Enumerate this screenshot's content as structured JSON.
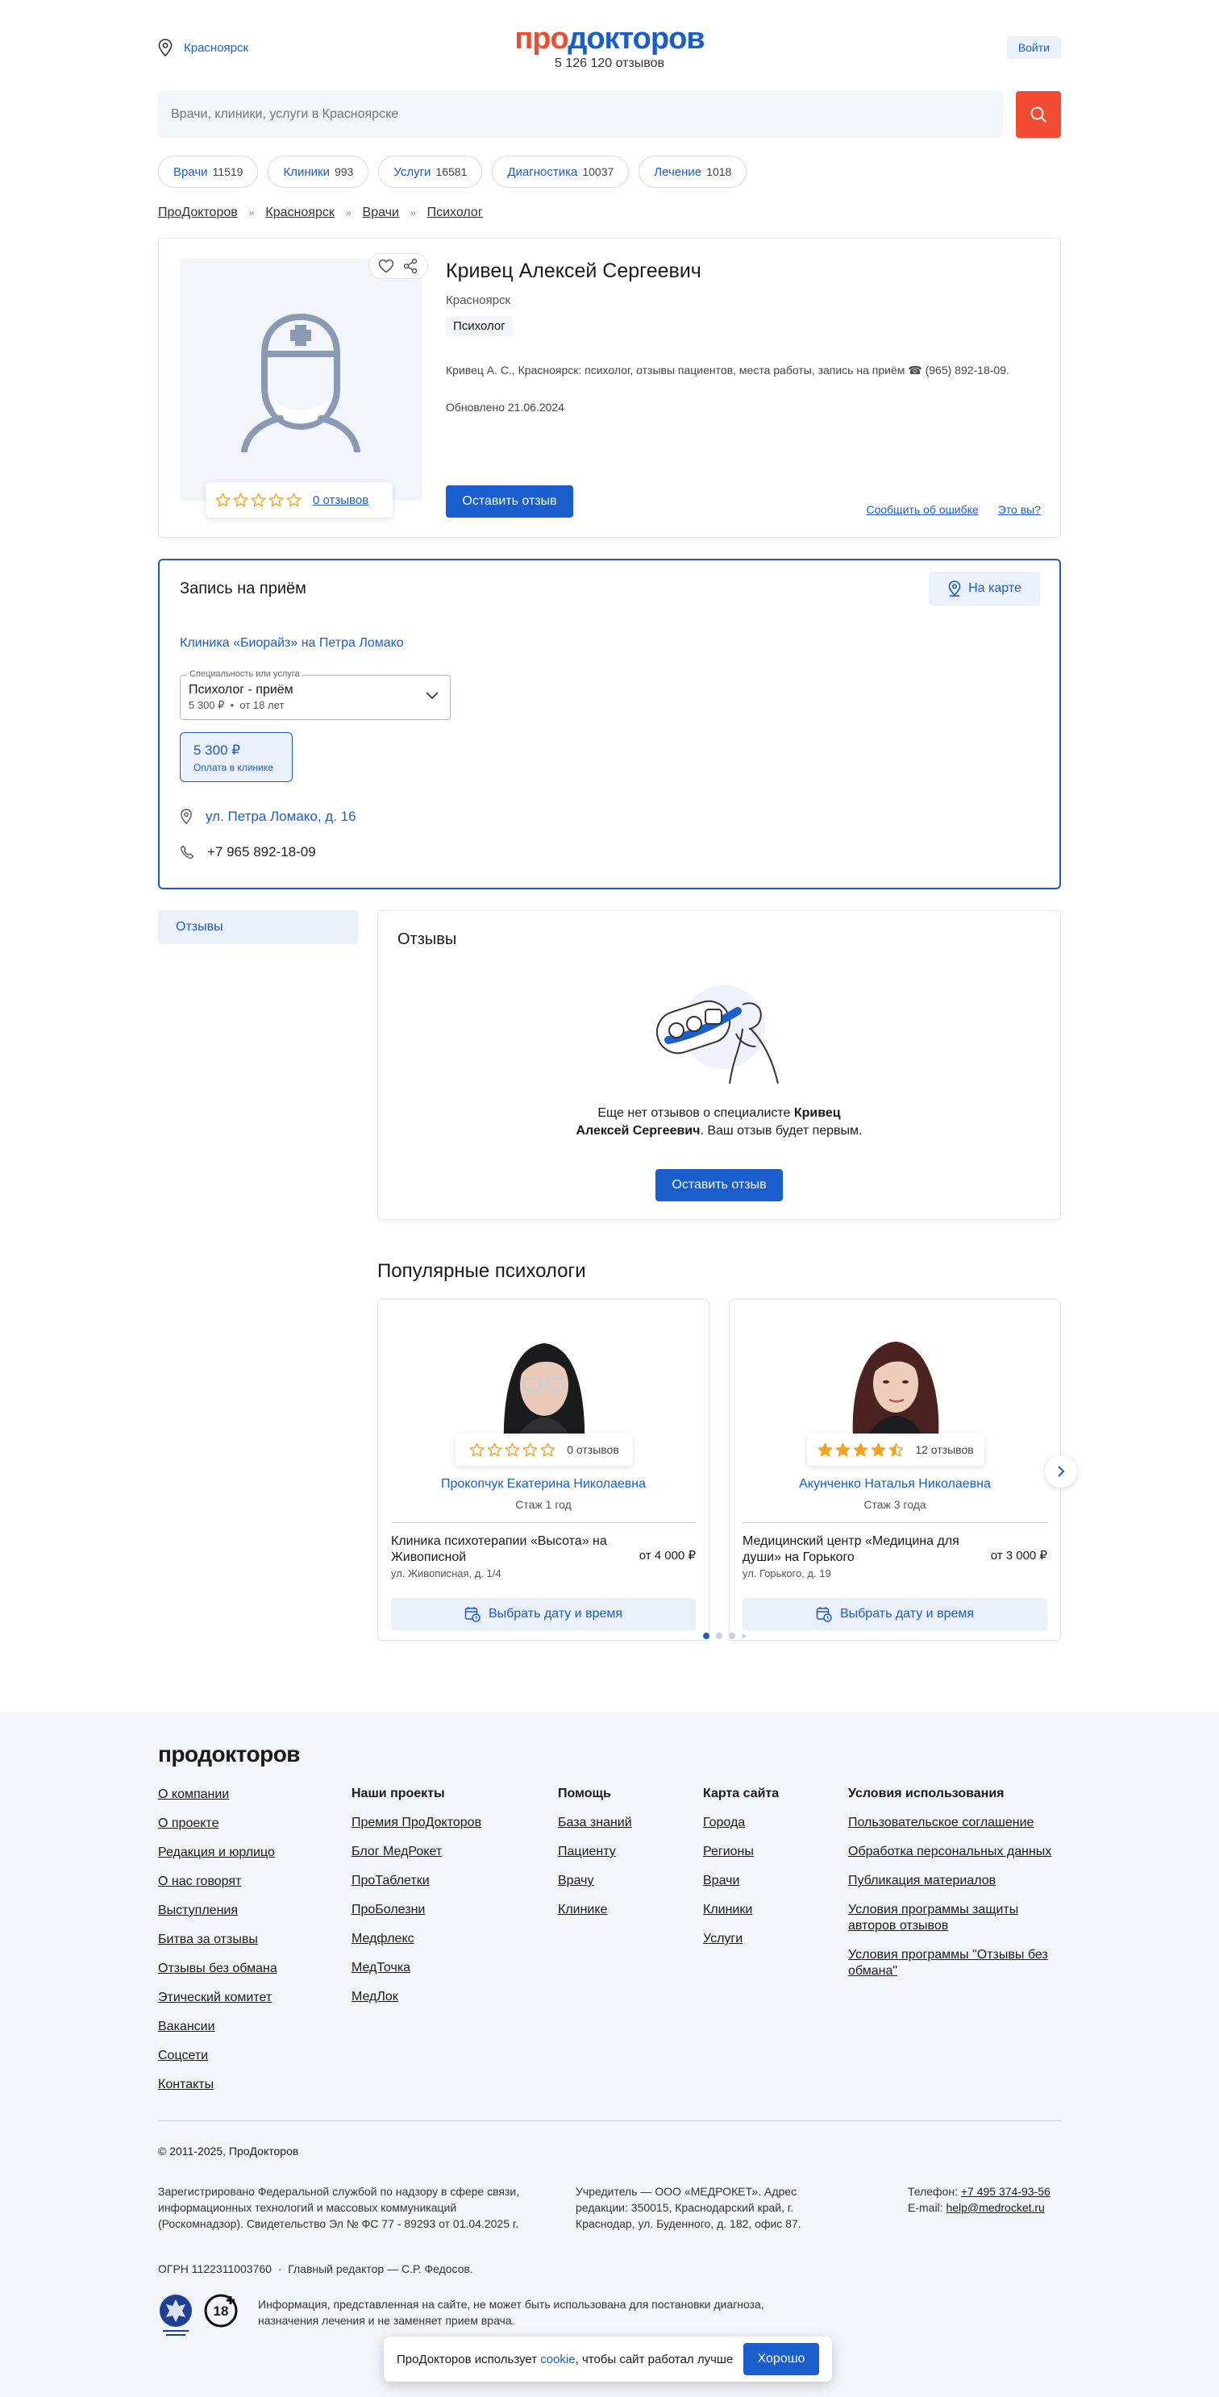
{
  "header": {
    "city": "Красноярск",
    "logo_pro": "про",
    "logo_rest": "докторов",
    "reviews_total": "5 126 120 отзывов",
    "login": "Войти"
  },
  "search": {
    "placeholder": "Врачи, клиники, услуги в Красноярске"
  },
  "chips": [
    {
      "label": "Врачи",
      "count": "11519"
    },
    {
      "label": "Клиники",
      "count": "993"
    },
    {
      "label": "Услуги",
      "count": "16581"
    },
    {
      "label": "Диагностика",
      "count": "10037"
    },
    {
      "label": "Лечение",
      "count": "1018"
    }
  ],
  "breadcrumbs": [
    "ПроДокторов",
    "Красноярск",
    "Врачи",
    "Психолог"
  ],
  "doctor": {
    "name": "Кривец Алексей Сергеевич",
    "city": "Красноярск",
    "specialty": "Психолог",
    "description": "Кривец А. С., Красноярск: психолог, отзывы пациентов, места работы, запись на приём ☎ (965) 892-18-09.",
    "updated": "Обновлено 21.06.2024",
    "reviews_link": "0 отзывов",
    "rating": 0,
    "leave_review": "Оставить отзыв",
    "report_error": "Сообщить об ошибке",
    "is_it_you": "Это вы?"
  },
  "appointment": {
    "title": "Запись на приём",
    "map_button": "На карте",
    "clinic": "Клиника «Биорайз» на Петра Ломако",
    "select_legend": "Специальность или услуга",
    "select_value": "Психолог - приём",
    "select_price": "5 300 ₽",
    "select_age": "от 18 лет",
    "price": "5 300 ₽",
    "price_note": "Оплата в клинике",
    "address": "ул. Петра Ломако, д. 16",
    "phone": "+7 965 892-18-09"
  },
  "reviews": {
    "side_tab": "Отзывы",
    "title": "Отзывы",
    "empty_1": "Еще нет отзывов о специалисте ",
    "empty_name_1": "Кривец",
    "empty_name_2": "Алексей Сергеевич",
    "empty_2": ". Ваш отзыв будет первым.",
    "button": "Оставить отзыв"
  },
  "popular": {
    "title": "Популярные психологи",
    "doctors": [
      {
        "name": "Прокопчук Екатерина Николаевна",
        "reviews": "0 отзывов",
        "rating": 0,
        "experience": "Стаж 1 год",
        "clinic": "Клиника психотерапии «Высота» на Живописной",
        "price": "от 4 000 ₽",
        "address": "ул. Живописная, д. 1/4",
        "button": "Выбрать дату и время"
      },
      {
        "name": "Акунченко Наталья Николаевна",
        "reviews": "12 отзывов",
        "rating": 4.5,
        "experience": "Стаж 3 года",
        "clinic": "Медицинский центр «Медицина для души» на Горького",
        "price": "от 3 000 ₽",
        "address": "ул. Горького, д. 19",
        "button": "Выбрать дату и время"
      }
    ]
  },
  "footer": {
    "logo": "продокторов",
    "col1": [
      "О компании",
      "О проекте",
      "Редакция и юрлицо",
      "О нас говорят",
      "Выступления",
      "Битва за отзывы",
      "Отзывы без обмана",
      "Этический комитет",
      "Вакансии",
      "Соцсети",
      "Контакты"
    ],
    "col2_title": "Наши проекты",
    "col2": [
      "Премия ПроДокторов",
      "Блог МедРокет",
      "ПроТаблетки",
      "ПроБолезни",
      "Медфлекс",
      "МедТочка",
      "МедЛок"
    ],
    "col3_title": "Помощь",
    "col3": [
      "База знаний",
      "Пациенту",
      "Врачу",
      "Клинике"
    ],
    "col4_title": "Карта сайта",
    "col4": [
      "Города",
      "Регионы",
      "Врачи",
      "Клиники",
      "Услуги"
    ],
    "col5_title": "Условия использования",
    "col5": [
      "Пользовательское соглашение",
      "Обработка персональных данных",
      "Публикация материалов",
      "Условия программы защиты авторов отзывов",
      "Условия программы \"Отзывы без обмана\""
    ],
    "copyright": "© 2011-2025, ПроДокторов",
    "registration": "Зарегистрировано Федеральной службой по надзору в сфере связи, информационных технологий и массовых коммуникаций (Роскомнадзор). Свидетельство Эл № ФС 77 - 89293 от 01.04.2025 г.",
    "founder": "Учредитель — ООО «МЕДРОКЕТ». Адрес редакции: 350015, Краснодарский край, г. Краснодар, ул. Буденного, д. 182, офис 87.",
    "phone_label": "Телефон: ",
    "phone": "+7 495 374-93-56",
    "email_label": "E-mail: ",
    "email": "help@medrocket.ru",
    "ogrn": "ОГРН 1122311003760",
    "editor": "Главный редактор — С.Р. Федосов.",
    "disclaimer": "Информация, представленная на сайте, не может быть использована для постановки диагноза, назначения лечения и не заменяет прием врача.",
    "age": "18"
  },
  "cookie": {
    "text_1": "ПроДокторов использует ",
    "link": "cookie",
    "text_2": ", чтобы сайт работал лучше",
    "button": "Хорошо"
  },
  "colors": {
    "accent": "#1a5dcc",
    "brand_red": "#ef4c2f",
    "star": "#f7a21b"
  }
}
